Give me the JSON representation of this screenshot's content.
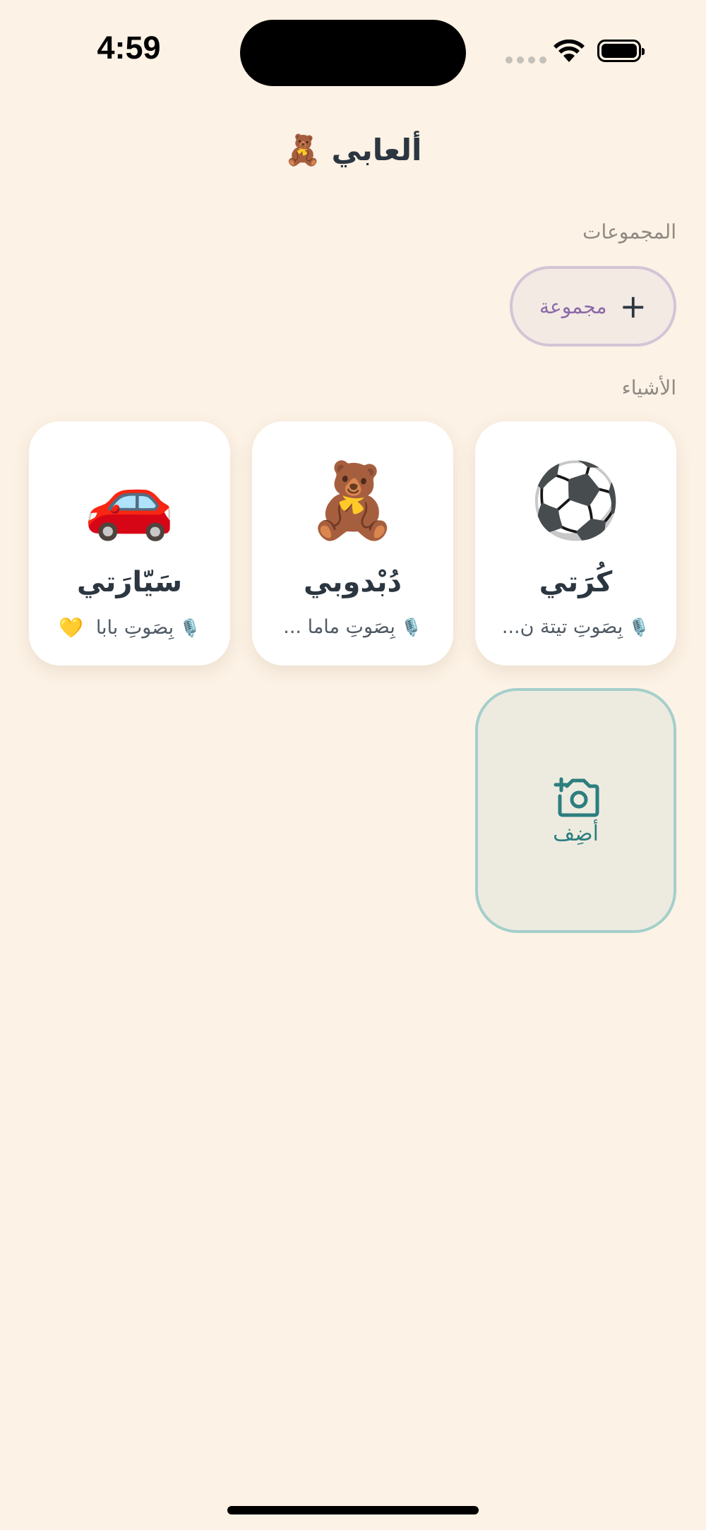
{
  "status_bar": {
    "time": "4:59"
  },
  "header": {
    "title": "ألعابي 🧸"
  },
  "groups_section": {
    "label": "المجموعات",
    "add_group_icon": "+",
    "add_group_label": "مجموعة"
  },
  "items_section": {
    "label": "الأشياء",
    "items": [
      {
        "emoji": "⚽",
        "name": "كُرَتي",
        "voice": "بِصَوتِ تيتة ن...",
        "mic": "🎙️"
      },
      {
        "emoji": "🧸",
        "name": "دُبْدوبي",
        "voice": "بِصَوتِ ماما ...",
        "mic": "🎙️"
      },
      {
        "emoji": "🚗",
        "name": "سَيّارَتي",
        "voice": "بِصَوتِ بابا",
        "mic": "🎙️",
        "heart": "💛"
      }
    ],
    "add_label": "أضِف"
  },
  "colors": {
    "background": "#fcf2e5",
    "accent_teal": "#2d7e7f",
    "group_purple": "#8b6aa8"
  },
  "icons": {
    "wifi": "wifi-icon",
    "battery": "battery-icon",
    "camera_add": "camera-plus-icon",
    "mic": "microphone-icon"
  }
}
